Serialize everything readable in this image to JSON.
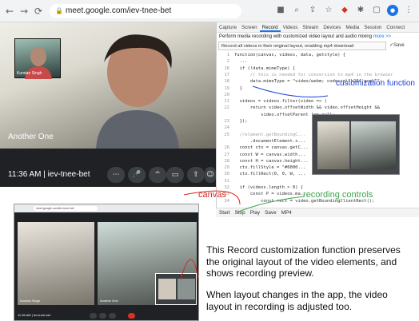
{
  "browser": {
    "url": "meet.google.com/iev-tnee-bet",
    "nav": {
      "back": "←",
      "forward": "→",
      "reload": "⟳"
    }
  },
  "meet": {
    "pip_name": "Kundan Singh",
    "speaker_name": "Another One",
    "time_code": "11:36 AM | iev-tnee-bet"
  },
  "panel": {
    "tabs": [
      "Capture",
      "Screen",
      "Record",
      "Videos",
      "Stream",
      "Devices",
      "Media",
      "Session",
      "Connect"
    ],
    "active_tab": "Record",
    "description": "Perform media recording with customized video layout and audio mixing",
    "more_link": "more >>",
    "select_value": "Record all videos in their original layout, enabling mp4 download",
    "save_label": "✓Save",
    "controls": [
      "Start",
      "Stop",
      "Play",
      "Save",
      "MP4"
    ]
  },
  "code_lines": [
    {
      "n": "1",
      "t": "function(canvas, videos, data, getstyle) {"
    },
    {
      "n": "2",
      "t": "  ..."
    },
    {
      "n": "16",
      "t": "  if (!data.mimeType) {"
    },
    {
      "n": "17",
      "t": "      // this is needed for conversion to mp4 in the browser"
    },
    {
      "n": "18",
      "t": "      data.mimeType = \"video/webm; codecs=\\\"h264,pcm\\\"\";"
    },
    {
      "n": "19",
      "t": "  }"
    },
    {
      "n": "20",
      "t": ""
    },
    {
      "n": "21",
      "t": "  videos = videos.filter(video => ("
    },
    {
      "n": "22",
      "t": "      return video.offsetWidth && video.offsetHeight &&"
    },
    {
      "n": "",
      "t": "          video.offsetParent !== null;"
    },
    {
      "n": "23",
      "t": "  });"
    },
    {
      "n": "24",
      "t": ""
    },
    {
      "n": "25",
      "t": "  //element.getBoundingC..."
    },
    {
      "n": "",
      "t": "      .documentElement.s..."
    },
    {
      "n": "26",
      "t": "  const ctx = canvas.getC..."
    },
    {
      "n": "27",
      "t": "  const W = canvas.width..."
    },
    {
      "n": "28",
      "t": "  const H = canvas.height..."
    },
    {
      "n": "29",
      "t": "  ctx.fillStyle = \"#0000..."
    },
    {
      "n": "30",
      "t": "  ctx.fillRect(0, 0, W, ..."
    },
    {
      "n": "31",
      "t": ""
    },
    {
      "n": "32",
      "t": "  if (videos.length > 0) {"
    },
    {
      "n": "33",
      "t": "      const P = videos.ma..."
    },
    {
      "n": "34",
      "t": "          const rect = video.getBoundingClientRect();"
    }
  ],
  "annotations": {
    "customization": "customization function",
    "canvas": "canvas",
    "recording_controls": "recording controls"
  },
  "small_shot": {
    "tile1_name": "Kundan Singh",
    "tile2_name": "Another One",
    "time_code": "11:36 AM | iev-tnee-bet"
  },
  "paragraphs": {
    "p1": "This Record customization function preserves the original layout of the video elements, and shows recording preview.",
    "p2": "When layout changes in the app, the video layout in recording is adjusted too."
  },
  "colors": {
    "annotation_blue": "#1a40d6",
    "annotation_red": "#d9261c",
    "annotation_green": "#3fa34d"
  }
}
